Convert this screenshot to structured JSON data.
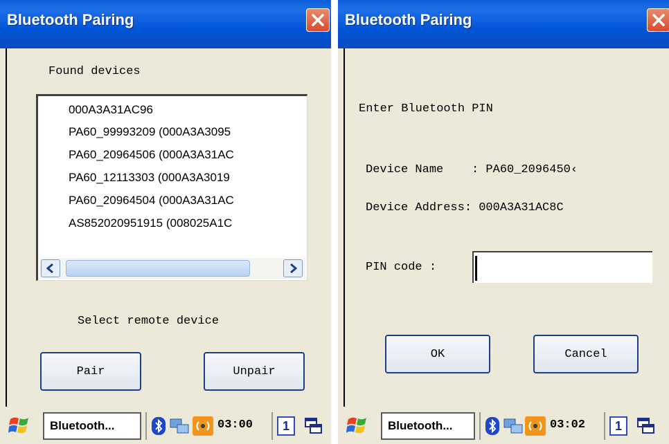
{
  "left": {
    "title": "Bluetooth Pairing",
    "found_label": "Found devices",
    "devices": [
      "000A3A31AC96",
      "PA60_99993209  (000A3A3095",
      "PA60_20964506  (000A3A31AC",
      "PA60_12113303  (000A3A3019",
      "PA60_20964504  (000A3A31AC",
      "AS852020951915  (008025A1C"
    ],
    "select_label": "Select remote device",
    "pair_label": "Pair",
    "unpair_label": "Unpair",
    "taskbar": {
      "task_label": "Bluetooth...",
      "clock": "03:00",
      "desktop_number": "1"
    }
  },
  "right": {
    "title": "Bluetooth Pairing",
    "enter_pin_label": "Enter Bluetooth PIN",
    "device_name_line": "Device Name    : PA60_2096450‹",
    "device_address_line": "Device Address: 000A3A31AC8C",
    "pin_label": "PIN code :",
    "pin_value": "",
    "ok_label": "OK",
    "cancel_label": "Cancel",
    "taskbar": {
      "task_label": "Bluetooth...",
      "clock": "03:02",
      "desktop_number": "1"
    }
  },
  "icons": {
    "close": "close-icon",
    "start": "windows-flag-icon",
    "bluetooth": "bluetooth-icon",
    "network": "network-icon",
    "wireless": "wireless-icon",
    "desktop_switch": "desktop-switch-icon",
    "scroll_left": "scroll-left-arrow-icon",
    "scroll_right": "scroll-right-arrow-icon"
  },
  "colors": {
    "titlebar": "#0055d6",
    "window_bg": "#ece9d8",
    "close": "#d54c2c",
    "button_border": "#1c3f8c"
  }
}
